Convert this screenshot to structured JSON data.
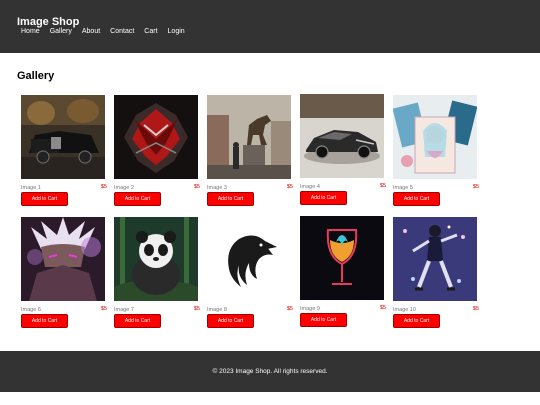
{
  "header": {
    "title": "Image Shop",
    "nav": [
      "Home",
      "Gallery",
      "About",
      "Contact",
      "Cart",
      "Login"
    ]
  },
  "main": {
    "heading": "Gallery",
    "button_label": "Add to Cart",
    "items": [
      {
        "name": "Image 1",
        "price": "$5",
        "subject": "black luxury car"
      },
      {
        "name": "Image 2",
        "price": "$5",
        "subject": "red metallic emblem"
      },
      {
        "name": "Image 3",
        "price": "$5",
        "subject": "horse statue and soldier"
      },
      {
        "name": "Image 4",
        "price": "$5",
        "subject": "silver sports car"
      },
      {
        "name": "Image 5",
        "price": "$5",
        "subject": "anime tarot cards"
      },
      {
        "name": "Image 6",
        "price": "$5",
        "subject": "anime warrior"
      },
      {
        "name": "Image 7",
        "price": "$5",
        "subject": "panda in forest"
      },
      {
        "name": "Image 8",
        "price": "$5",
        "subject": "black bird logo"
      },
      {
        "name": "Image 9",
        "price": "$5",
        "subject": "neon wine glass"
      },
      {
        "name": "Image 10",
        "price": "$5",
        "subject": "dancer with sparkles"
      }
    ]
  },
  "footer": {
    "text": "© 2023 Image Shop. All rights reserved."
  },
  "colors": {
    "header_bg": "#333333",
    "button_bg": "#ff0000",
    "price": "#e00000"
  }
}
